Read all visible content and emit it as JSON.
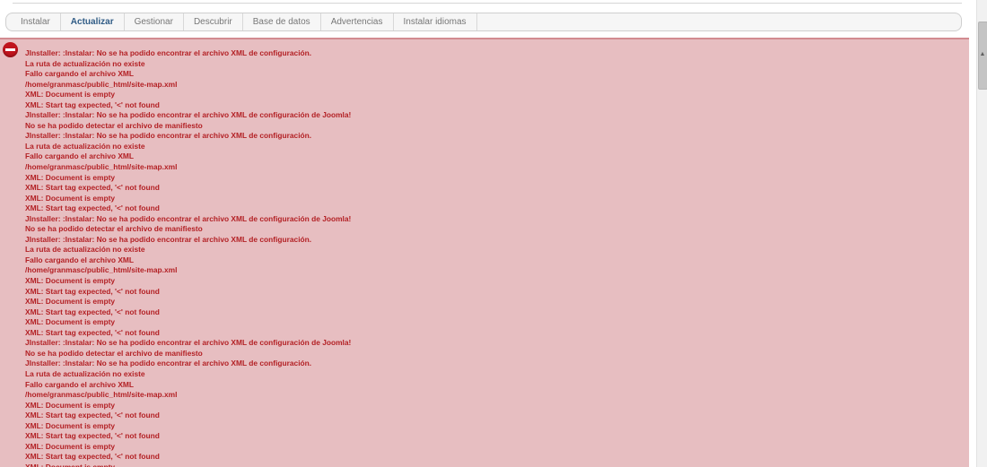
{
  "tabs": [
    {
      "label": "Instalar",
      "active": false
    },
    {
      "label": "Actualizar",
      "active": true
    },
    {
      "label": "Gestionar",
      "active": false
    },
    {
      "label": "Descubrir",
      "active": false
    },
    {
      "label": "Base de datos",
      "active": false
    },
    {
      "label": "Advertencias",
      "active": false
    },
    {
      "label": "Instalar idiomas",
      "active": false
    }
  ],
  "error_panel": {
    "icon": "error-stop-icon",
    "messages": [
      "JInstaller: :Instalar: No se ha podido encontrar el archivo XML de configuración.",
      "La ruta de actualización no existe",
      "Fallo cargando el archivo XML",
      "/home/granmasc/public_html/site-map.xml",
      "XML: Document is empty",
      "XML: Start tag expected, '<' not found",
      "JInstaller: :Instalar: No se ha podido encontrar el archivo XML de configuración de Joomla!",
      "No se ha podido detectar el archivo de manifiesto",
      "JInstaller: :Instalar: No se ha podido encontrar el archivo XML de configuración.",
      "La ruta de actualización no existe",
      "Fallo cargando el archivo XML",
      "/home/granmasc/public_html/site-map.xml",
      "XML: Document is empty",
      "XML: Start tag expected, '<' not found",
      "XML: Document is empty",
      "XML: Start tag expected, '<' not found",
      "JInstaller: :Instalar: No se ha podido encontrar el archivo XML de configuración de Joomla!",
      "No se ha podido detectar el archivo de manifiesto",
      "JInstaller: :Instalar: No se ha podido encontrar el archivo XML de configuración.",
      "La ruta de actualización no existe",
      "Fallo cargando el archivo XML",
      "/home/granmasc/public_html/site-map.xml",
      "XML: Document is empty",
      "XML: Start tag expected, '<' not found",
      "XML: Document is empty",
      "XML: Start tag expected, '<' not found",
      "XML: Document is empty",
      "XML: Start tag expected, '<' not found",
      "JInstaller: :Instalar: No se ha podido encontrar el archivo XML de configuración de Joomla!",
      "No se ha podido detectar el archivo de manifiesto",
      "JInstaller: :Instalar: No se ha podido encontrar el archivo XML de configuración.",
      "La ruta de actualización no existe",
      "Fallo cargando el archivo XML",
      "/home/granmasc/public_html/site-map.xml",
      "XML: Document is empty",
      "XML: Start tag expected, '<' not found",
      "XML: Document is empty",
      "XML: Start tag expected, '<' not found",
      "XML: Document is empty",
      "XML: Start tag expected, '<' not found",
      "XML: Document is empty"
    ]
  },
  "colors": {
    "error_text": "#b32125",
    "error_background": "#e7bec1",
    "active_tab": "#2f5b85"
  }
}
